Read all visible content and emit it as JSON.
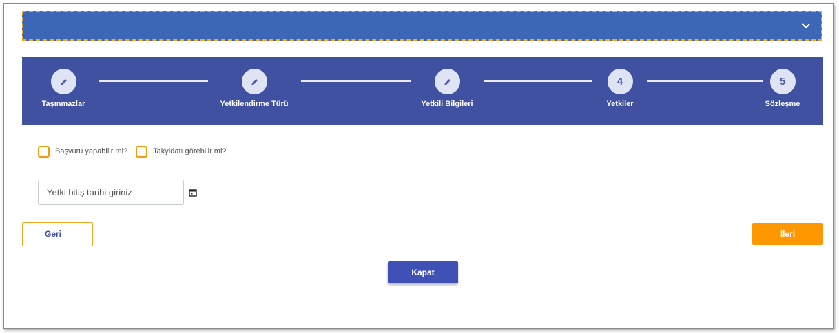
{
  "accordion": {
    "icon": "chevron-down-icon"
  },
  "stepper": {
    "steps": [
      {
        "label": "Taşınmazlar",
        "icon": "pencil-icon",
        "number": ""
      },
      {
        "label": "Yetkilendirme Türü",
        "icon": "pencil-icon",
        "number": ""
      },
      {
        "label": "Yetkili Bilgileri",
        "icon": "pencil-icon",
        "number": ""
      },
      {
        "label": "Yetkiler",
        "icon": "",
        "number": "4"
      },
      {
        "label": "Sözleşme",
        "icon": "",
        "number": "5"
      }
    ]
  },
  "permissions": {
    "apply_label": "Başvuru yapabilir mi?",
    "view_label": "Takyidatı görebilir mi?"
  },
  "date": {
    "placeholder": "Yetki bitiş tarihi giriniz",
    "icon": "calendar-icon"
  },
  "buttons": {
    "back": "Geri",
    "next": "İleri",
    "close": "Kapat"
  },
  "colors": {
    "accordion_bg": "#3c66b6",
    "stepper_bg": "#3f51a0",
    "accent_orange": "#ff9800",
    "primary_blue": "#3f51b5"
  }
}
